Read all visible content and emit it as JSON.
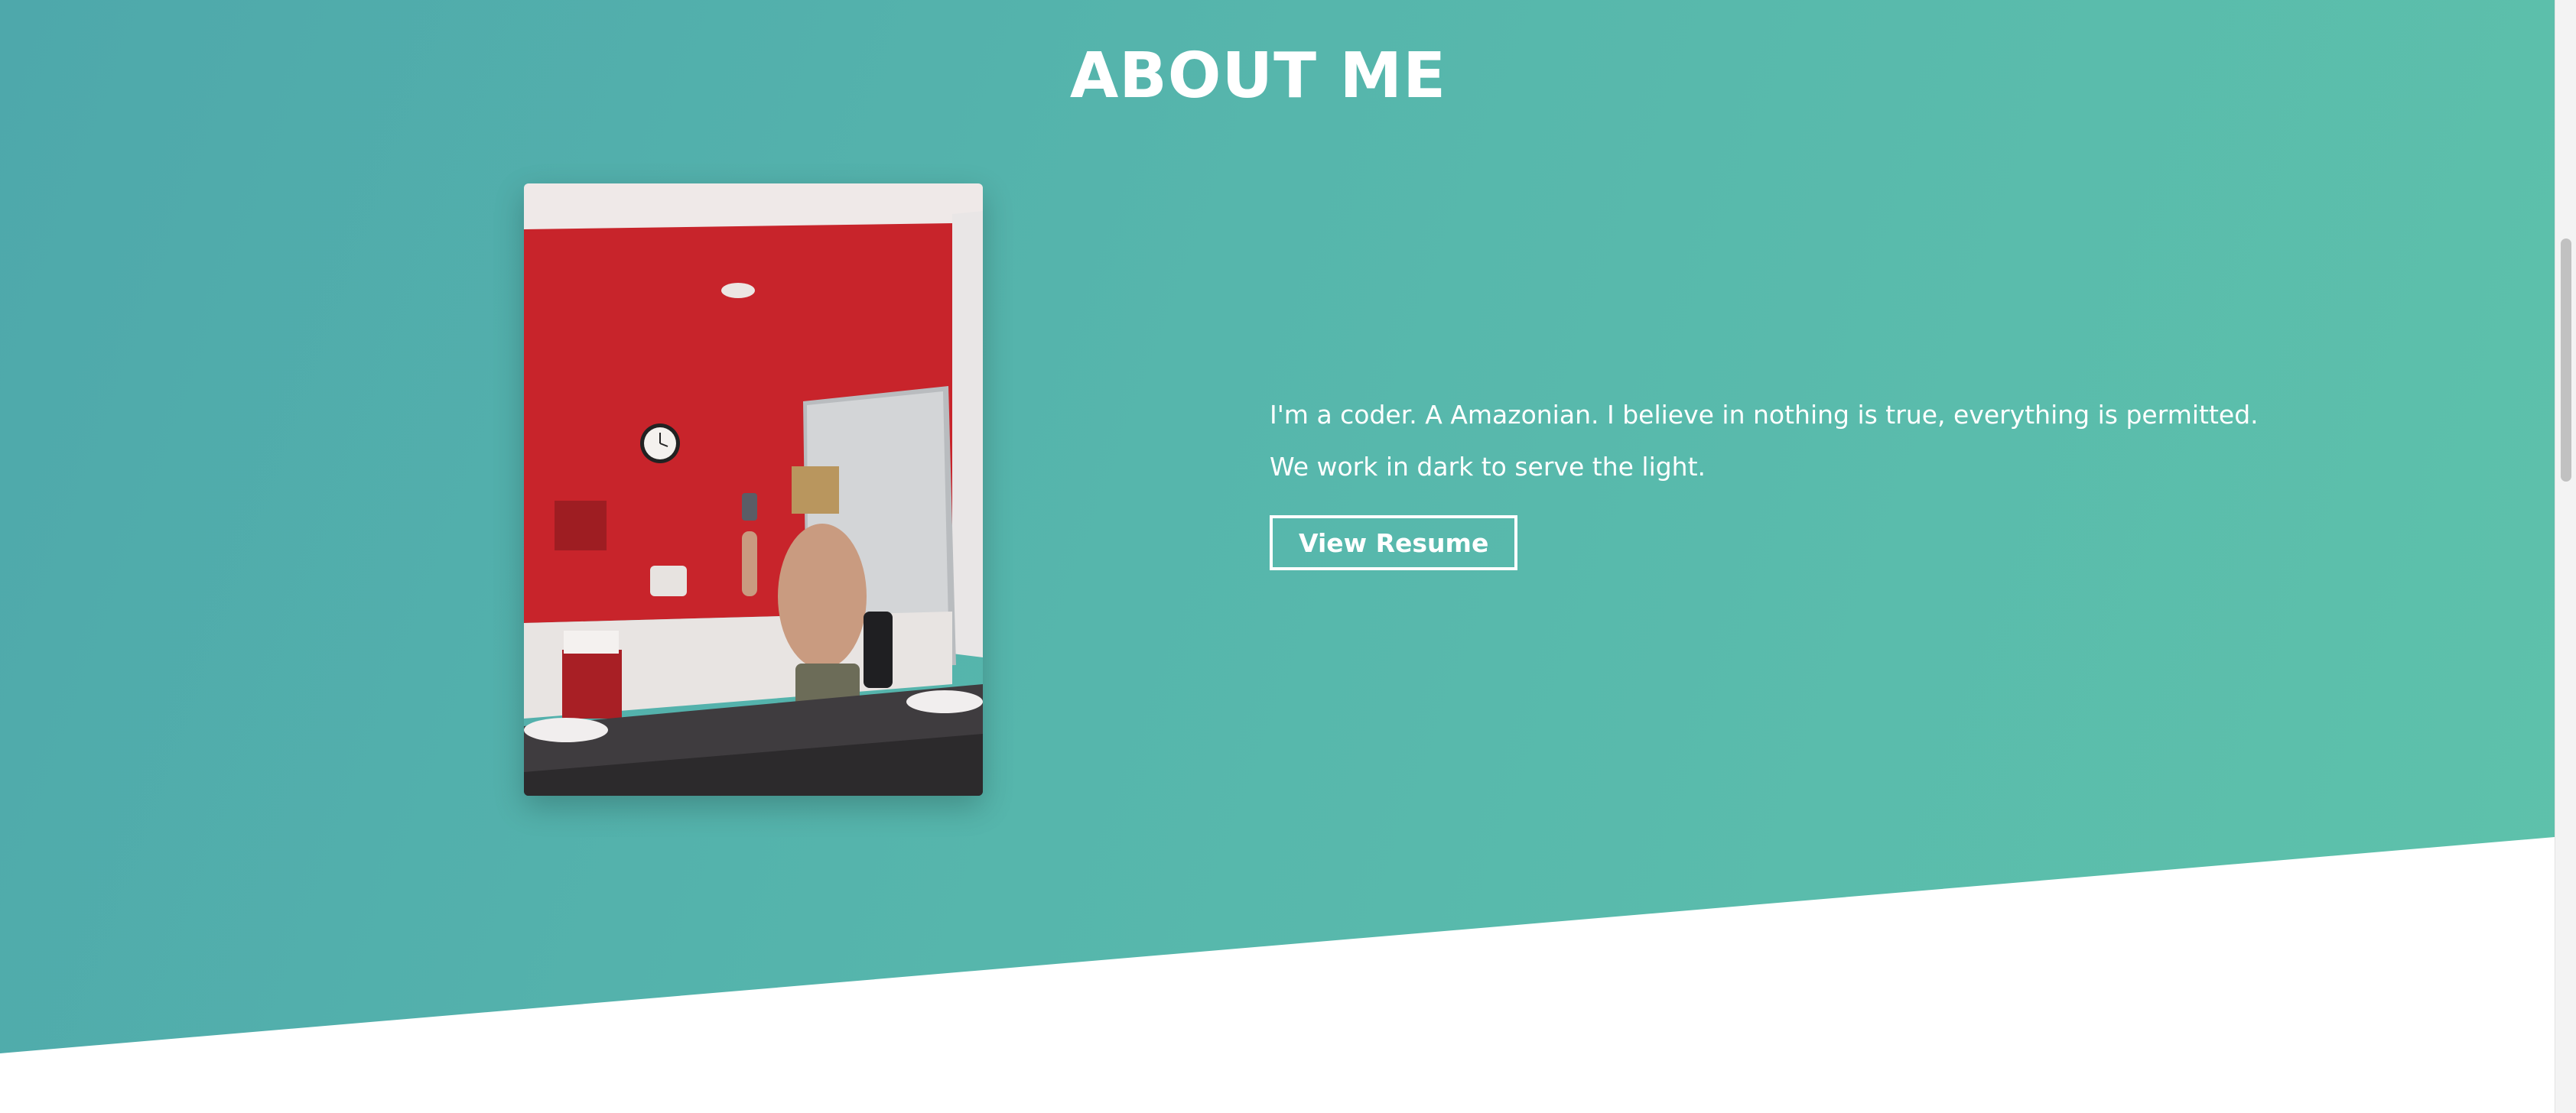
{
  "section": {
    "title": "ABOUT ME"
  },
  "bio": {
    "line1": "I'm a coder. A Amazonian. I believe in nothing is true, everything is permitted.",
    "line2": "We work in dark to serve the light."
  },
  "buttons": {
    "resume_label": "View Resume"
  },
  "colors": {
    "gradient_start": "#4ea8ab",
    "gradient_end": "#5ec2ab",
    "text": "#ffffff",
    "below_section": "#ffffff"
  },
  "photo": {
    "icon": "profile-photo"
  }
}
